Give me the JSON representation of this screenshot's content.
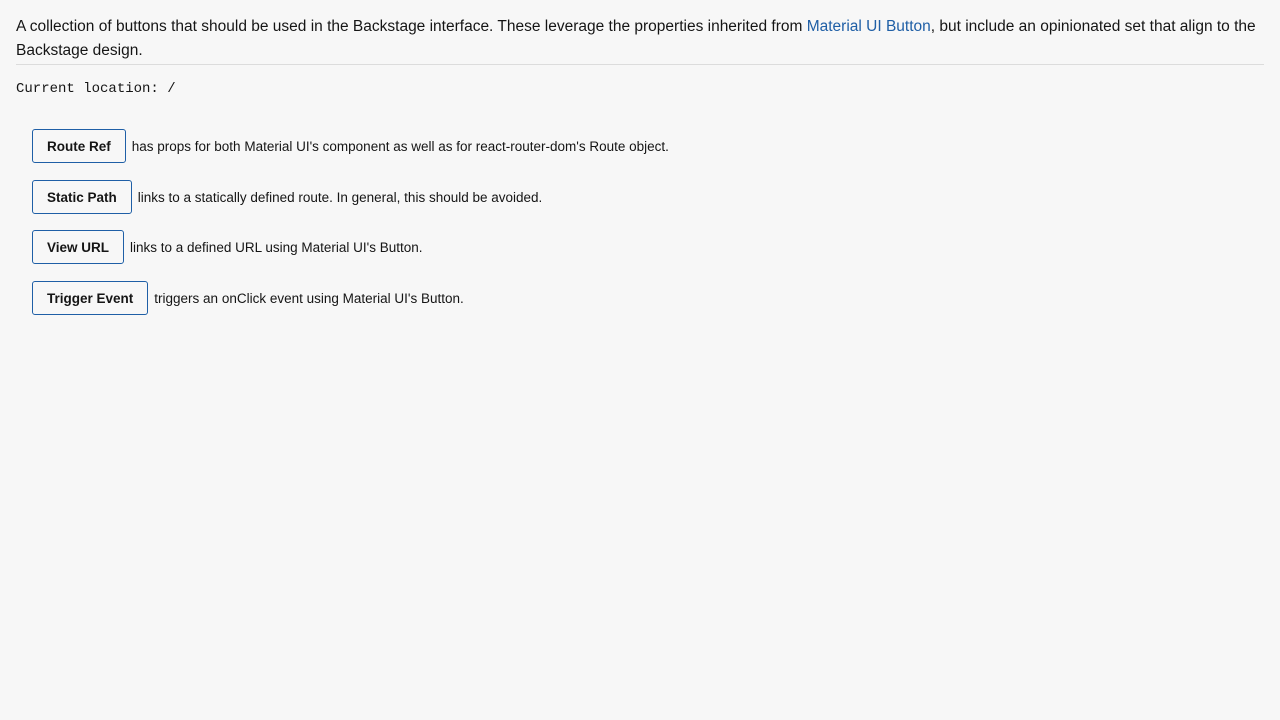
{
  "intro": {
    "text_before": "A collection of buttons that should be used in the Backstage interface. These leverage the properties inherited from ",
    "link_label": "Material UI Button",
    "text_after": ", but include an opinionated set that align to the Backstage design."
  },
  "location": {
    "label": "Current location: /"
  },
  "buttons": [
    {
      "label": "Route Ref",
      "description": "has props for both Material UI's component as well as for react-router-dom's Route object."
    },
    {
      "label": "Static Path",
      "description": "links to a statically defined route. In general, this should be avoided."
    },
    {
      "label": "View URL",
      "description": "links to a defined URL using Material UI's Button."
    },
    {
      "label": "Trigger Event",
      "description": "triggers an onClick event using Material UI's Button."
    }
  ],
  "colors": {
    "accent": "#1f5fa6",
    "background": "#f7f7f7",
    "text": "#151515"
  }
}
